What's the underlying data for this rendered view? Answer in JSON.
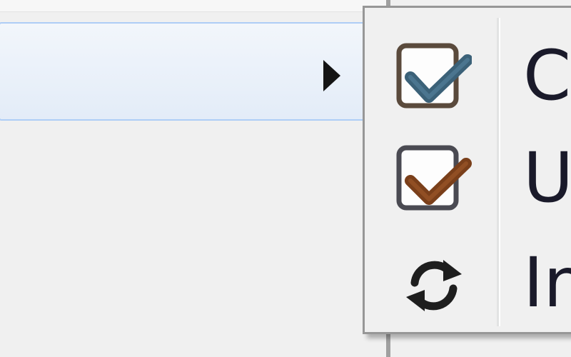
{
  "context_menu": {
    "submenu": {
      "items": [
        {
          "label": "C",
          "icon": "checkbox-checked-blue-icon",
          "label_color": "#1a1a2a",
          "check_color": "#3b6178"
        },
        {
          "label": "U",
          "icon": "checkbox-checked-brown-icon",
          "label_color": "#1a1a2a",
          "check_color": "#7a3f1a"
        },
        {
          "label": "In",
          "icon": "refresh-icon",
          "label_color": "#1a1a2a"
        }
      ]
    }
  }
}
